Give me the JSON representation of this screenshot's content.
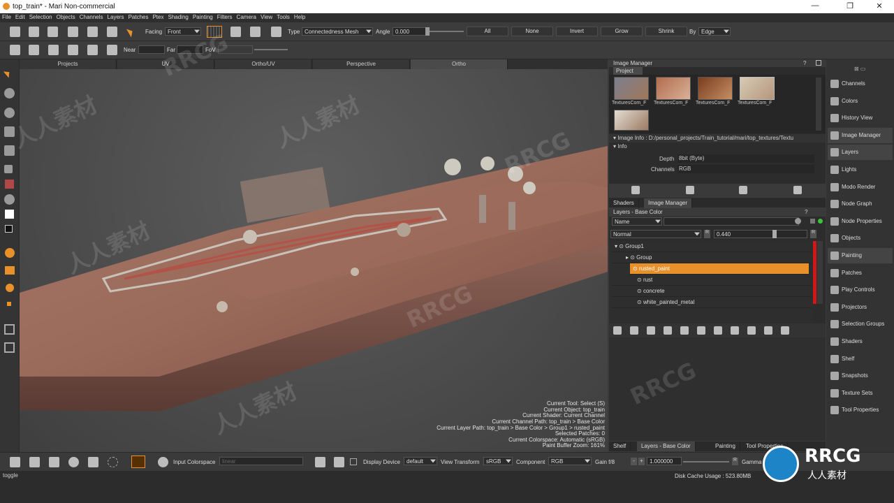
{
  "window": {
    "title": "top_train* - Mari Non-commercial",
    "minimize": "—",
    "maximize": "❐",
    "close": "✕"
  },
  "menu": [
    "File",
    "Edit",
    "Selection",
    "Objects",
    "Channels",
    "Layers",
    "Patches",
    "Ptex",
    "Shading",
    "Painting",
    "Filters",
    "Camera",
    "View",
    "Tools",
    "Help"
  ],
  "toolbar1": {
    "facing_label": "Facing",
    "facing_value": "Front",
    "type_label": "Type",
    "type_value": "Connectedness Mesh",
    "angle_label": "Angle",
    "angle_value": "0.000",
    "buttons": [
      "All",
      "None",
      "Invert",
      "Grow",
      "Shrink"
    ],
    "by_label": "By",
    "by_value": "Edge"
  },
  "toolbar2": {
    "near_label": "Near",
    "far_label": "Far",
    "fov_label": "FoV"
  },
  "view_tabs": [
    "Projects",
    "UV",
    "Ortho/UV",
    "Perspective",
    "Ortho"
  ],
  "viewport_info": [
    "Current Tool: Select (S)",
    "Current Object: top_train",
    "Current Shader: Current Channel",
    "Current Channel Path: top_train > Base Color",
    "Current Layer Path: top_train > Base Color > Group1 > rusted_paint",
    "Selected Patches: 0",
    "Current Colorspace: Automatic (sRGB)",
    "Paint Buffer Zoom: 161%"
  ],
  "image_manager": {
    "title": "Image Manager",
    "tab": "Project",
    "thumbs": [
      "TexturesCom_F",
      "TexturesCom_F",
      "TexturesCom_F",
      "TexturesCom_F",
      ""
    ],
    "info_title": "Image Info : D:/personal_projects/Train_tutorial/mari/top_textures/Textu",
    "info_section": "Info",
    "depth_label": "Depth",
    "depth_value": "8bit  (Byte)",
    "channels_label": "Channels",
    "channels_value": "RGB"
  },
  "mid_tabs": [
    "Shaders",
    "Image Manager"
  ],
  "layers": {
    "title": "Layers - Base Color",
    "filter_value": "Name",
    "blend": "Normal",
    "opacity": "0.440",
    "rows": [
      {
        "name": "Group1",
        "indent": 0,
        "selected": false
      },
      {
        "name": "Group",
        "indent": 1,
        "selected": false
      },
      {
        "name": "rusted_paint",
        "indent": 2,
        "selected": true
      },
      {
        "name": "rust",
        "indent": 2,
        "selected": false
      },
      {
        "name": "concrete",
        "indent": 2,
        "selected": false
      },
      {
        "name": "white_painted_metal",
        "indent": 2,
        "selected": false
      }
    ]
  },
  "bottom_tabs": [
    "Shelf",
    "Layers - Base Color",
    "Painting",
    "Tool Properties"
  ],
  "right_palettes": [
    "Channels",
    "Colors",
    "History View",
    "Image Manager",
    "Layers",
    "Lights",
    "Modo Render",
    "Node Graph",
    "Node Properties",
    "Objects",
    "Painting",
    "Patches",
    "Play Controls",
    "Projectors",
    "Selection Groups",
    "Shaders",
    "Shelf",
    "Snapshots",
    "Texture Sets",
    "Tool Properties"
  ],
  "bottom_bar": {
    "input_cs_label": "Input Colorspace",
    "input_cs_value": "linear",
    "display_label": "Display Device",
    "display_value": "default",
    "view_tf_label": "View Transform",
    "view_tf_value": "sRGB",
    "component_label": "Component",
    "component_value": "RGB",
    "gain_label": "Gain f/8",
    "gain_value": "1.000000",
    "gamma_label": "Gamma"
  },
  "status": {
    "left": "toggle",
    "right": "Disk Cache Usage : 523.80MB"
  },
  "watermarks": [
    "RRCG",
    "人人素材",
    "RRCG",
    "人人素材",
    "RRCG",
    "人人素材",
    "RRCG",
    "人人素材"
  ],
  "logo": {
    "text": "RRCG",
    "sub": "人人素材"
  },
  "colors": {
    "accent": "#e8912a",
    "redbar": "#d01818"
  }
}
